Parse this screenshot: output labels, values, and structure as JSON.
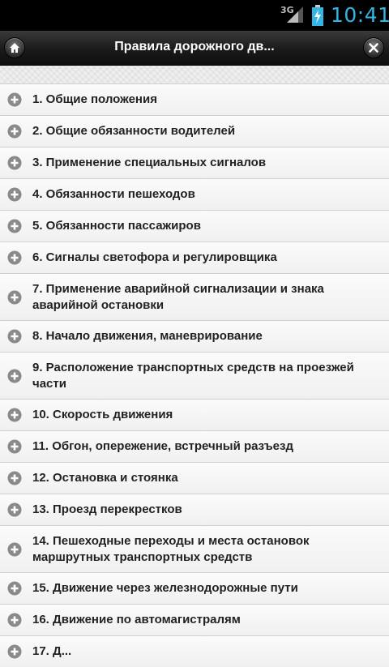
{
  "status_bar": {
    "network": "3G",
    "time": "10:41",
    "signal_icon": "signal-icon",
    "battery_icon": "battery-charging-icon",
    "accent_color": "#33b5e5"
  },
  "header": {
    "title": "Правила дорожного дв...",
    "home_icon": "home-icon",
    "close_icon": "close-icon"
  },
  "list": {
    "expand_icon": "plus-circle-icon",
    "items": [
      {
        "label": "1. Общие положения"
      },
      {
        "label": "2. Общие обязанности водителей"
      },
      {
        "label": "3. Применение специальных сигналов"
      },
      {
        "label": "4. Обязанности пешеходов"
      },
      {
        "label": "5. Обязанности пассажиров"
      },
      {
        "label": "6. Сигналы светофора и регулировщика"
      },
      {
        "label": "7. Применение аварийной сигнализации и знака аварийной остановки"
      },
      {
        "label": "8. Начало движения, маневрирование"
      },
      {
        "label": "9. Расположение транспортных средств на проезжей части"
      },
      {
        "label": "10. Скорость движения"
      },
      {
        "label": "11. Обгон, опережение, встречный разъезд"
      },
      {
        "label": "12. Остановка и стоянка"
      },
      {
        "label": "13. Проезд перекрестков"
      },
      {
        "label": "14. Пешеходные переходы и места остановок маршрутных транспортных средств"
      },
      {
        "label": "15. Движение через железнодорожные пути"
      },
      {
        "label": "16. Движение по автомагистралям"
      },
      {
        "label": "17. Д..."
      }
    ]
  }
}
